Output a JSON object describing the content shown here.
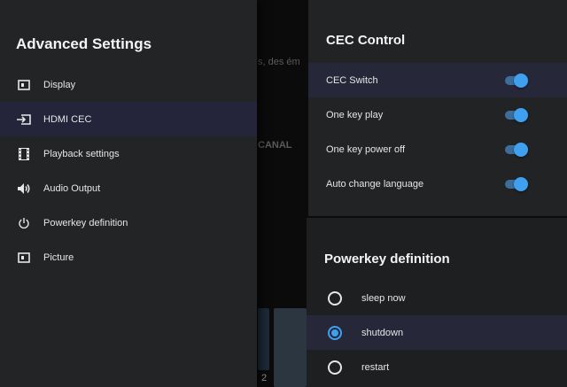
{
  "background": {
    "snippet_1": "s, des ém",
    "snippet_2": "CANAL",
    "snippet_3": "2"
  },
  "left_panel": {
    "title": "Advanced Settings",
    "items": [
      {
        "label": "Display",
        "icon": "display-icon"
      },
      {
        "label": "HDMI CEC",
        "icon": "input-icon"
      },
      {
        "label": "Playback settings",
        "icon": "film-icon"
      },
      {
        "label": "Audio Output",
        "icon": "speaker-icon"
      },
      {
        "label": "Powerkey definition",
        "icon": "power-icon"
      },
      {
        "label": "Picture",
        "icon": "picture-icon"
      }
    ]
  },
  "cec_panel": {
    "title": "CEC Control",
    "toggles": [
      {
        "label": "CEC Switch",
        "on": true
      },
      {
        "label": "One key play",
        "on": true
      },
      {
        "label": "One key power off",
        "on": true
      },
      {
        "label": "Auto change language",
        "on": true
      }
    ]
  },
  "power_panel": {
    "title": "Powerkey definition",
    "options": [
      {
        "label": "sleep now",
        "selected": false
      },
      {
        "label": "shutdown",
        "selected": true
      },
      {
        "label": "restart",
        "selected": false
      }
    ]
  },
  "colors": {
    "accent": "#40a0f0",
    "panel": "#232425",
    "highlight": "#24243a"
  }
}
